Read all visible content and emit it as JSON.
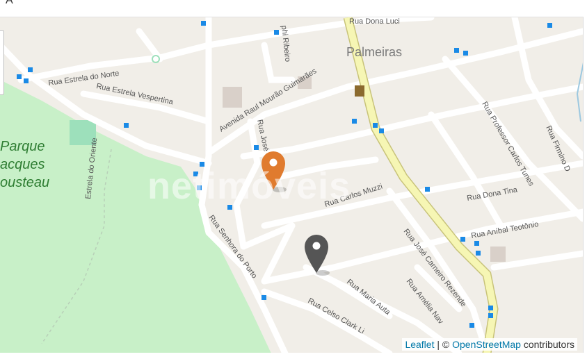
{
  "header": {
    "glyph": "A"
  },
  "map": {
    "watermark": "netimóveis",
    "labels": {
      "palmeiras": "Palmeiras",
      "parque_line1": "Parque",
      "parque_line2": "acques",
      "parque_line3": "ousteau",
      "rua_dona_luci": "Rua Dona Luci",
      "rua_estrela_norte": "Rua Estrela do Norte",
      "rua_estrela_vespertina": "Rua Estrela Vespertina",
      "avenida_raul": "Avenida Raul Mourão Guimarães",
      "rua_jose": "Rua José",
      "rua_carlos_muzzi": "Rua Carlos Muzzi",
      "rua_senhora_porto": "Rua Senhora do Porto",
      "estrela_oriente": "Estrela do Oriente",
      "rua_professor": "Rua Professor Carlos Tunes",
      "rua_firmino": "Rua Firmino D",
      "rua_dona_tina": "Rua Dona Tina",
      "rua_anibal": "Rua Aníbal Teotônio",
      "rua_jose_carneiro": "Rua José Carneiro Rezende",
      "rua_maria_auta": "Rua Maria Auta",
      "rua_celso": "Rua Celso Clark Li",
      "rua_amelia": "Rua Amélia Nav",
      "phi_ribeiro": "phi Ribeiro"
    },
    "markers": [
      {
        "name": "orange-marker",
        "color": "#e07b2e"
      },
      {
        "name": "dark-marker",
        "color": "#555555"
      }
    ],
    "colors": {
      "park": "#c8f0c8",
      "road": "#ffffff",
      "primary_road": "#f6f6b4",
      "bus_stop": "#1a8ae6"
    }
  },
  "attribution": {
    "leaflet": "Leaflet",
    "sep": " | © ",
    "osm": "OpenStreetMap",
    "suffix": " contributors"
  }
}
